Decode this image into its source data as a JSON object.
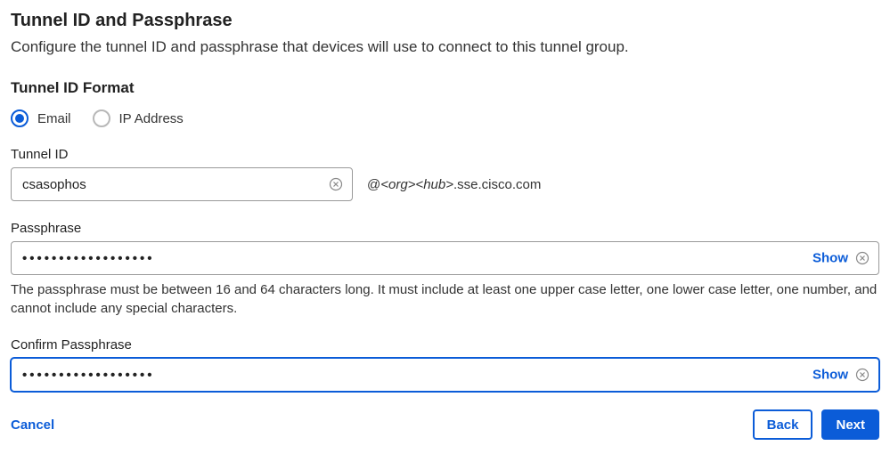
{
  "header": {
    "title": "Tunnel ID and Passphrase",
    "description": "Configure the tunnel ID and passphrase that devices will use to connect to this tunnel group."
  },
  "format": {
    "heading": "Tunnel ID Format",
    "options": [
      "Email",
      "IP Address"
    ],
    "selected": "Email"
  },
  "tunnel": {
    "label": "Tunnel ID",
    "value": "csasophos",
    "suffix_prefix": "@",
    "suffix_italic": "<org><hub>",
    "suffix_rest": ".sse.cisco.com"
  },
  "passphrase": {
    "label": "Passphrase",
    "value": "••••••••••••••••••",
    "show_label": "Show",
    "helper": "The passphrase must be between 16 and 64 characters long. It must include at least one upper case letter, one lower case letter, one number, and cannot include any special characters."
  },
  "confirm": {
    "label": "Confirm Passphrase",
    "value": "••••••••••••••••••",
    "show_label": "Show"
  },
  "footer": {
    "cancel": "Cancel",
    "back": "Back",
    "next": "Next"
  }
}
